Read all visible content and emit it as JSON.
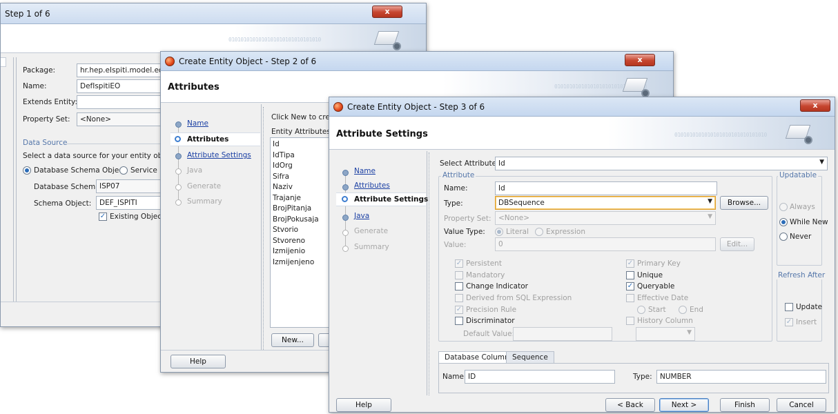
{
  "win1": {
    "title": "Step 1 of 6",
    "close_label": "x",
    "package": {
      "label": "Package:",
      "value": "hr.hep.eIspiti.model.eo"
    },
    "name": {
      "label": "Name:",
      "value": "DefIspitiEO"
    },
    "extends": {
      "label": "Extends Entity:",
      "value": ""
    },
    "property_set": {
      "label": "Property Set:",
      "value": "<None>"
    },
    "data_source_title": "Data Source",
    "data_source_desc": "Select a data source for your entity object.",
    "radio_db": "Database Schema Object",
    "radio_service": "Service In",
    "db_schema": {
      "label": "Database Schema:",
      "value": "ISP07"
    },
    "schema_object": {
      "label": "Schema Object:",
      "value": "DEF_ISPITI"
    },
    "existing_object": "Existing Object"
  },
  "win2": {
    "title": "Create Entity Object - Step 2 of 6",
    "close_label": "x",
    "banner_title": "Attributes",
    "nav": [
      "Name",
      "Attributes",
      "Attribute Settings",
      "Java",
      "Generate",
      "Summary"
    ],
    "hint": "Click New to creat",
    "entity_attrs_label": "Entity Attributes:",
    "entity_attrs": [
      "Id",
      "IdTipa",
      "IdOrg",
      "Sifra",
      "Naziv",
      "Trajanje",
      "BrojPitanja",
      "BrojPokusaja",
      "Stvorio",
      "Stvoreno",
      "Izmijenio",
      "Izmijenjeno"
    ],
    "new_button": "New...",
    "help_button": "Help"
  },
  "win3": {
    "title": "Create Entity Object - Step 3 of 6",
    "close_label": "x",
    "banner_title": "Attribute Settings",
    "banner_bits": "0101010101010101010101010101010",
    "nav": [
      "Name",
      "Attributes",
      "Attribute Settings",
      "Java",
      "Generate",
      "Summary"
    ],
    "select_attr": {
      "label": "Select Attribute",
      "value": "Id"
    },
    "attribute_group": "Attribute",
    "attr_name": {
      "label": "Name:",
      "value": "Id"
    },
    "attr_type": {
      "label": "Type:",
      "value": "DBSequence"
    },
    "browse_button": "Browse...",
    "property_set": {
      "label": "Property Set:",
      "value": "<None>"
    },
    "value_type": {
      "label": "Value Type:",
      "literal": "Literal",
      "expression": "Expression"
    },
    "value": {
      "label": "Value:",
      "value": "0"
    },
    "edit_button": "Edit...",
    "checks_left": [
      "Persistent",
      "Mandatory",
      "Change Indicator",
      "Derived from SQL Expression",
      "Precision Rule",
      "Discriminator"
    ],
    "default_value_label": "Default Value:",
    "checks_right": [
      "Primary Key",
      "Unique",
      "Queryable",
      "Effective Date"
    ],
    "start_label": "Start",
    "end_label": "End",
    "history_column": "History Column",
    "updatable": {
      "title": "Updatable",
      "options": [
        "Always",
        "While New",
        "Never"
      ]
    },
    "refresh_after": {
      "title": "Refresh After",
      "update": "Update",
      "insert": "Insert"
    },
    "tabs": [
      "Database Column",
      "Sequence"
    ],
    "col_name": {
      "label": "Name:",
      "value": "ID"
    },
    "col_type": {
      "label": "Type:",
      "value": "NUMBER"
    },
    "help_button": "Help",
    "back_button": "< Back",
    "next_button": "Next >",
    "finish_button": "Finish",
    "cancel_button": "Cancel"
  }
}
